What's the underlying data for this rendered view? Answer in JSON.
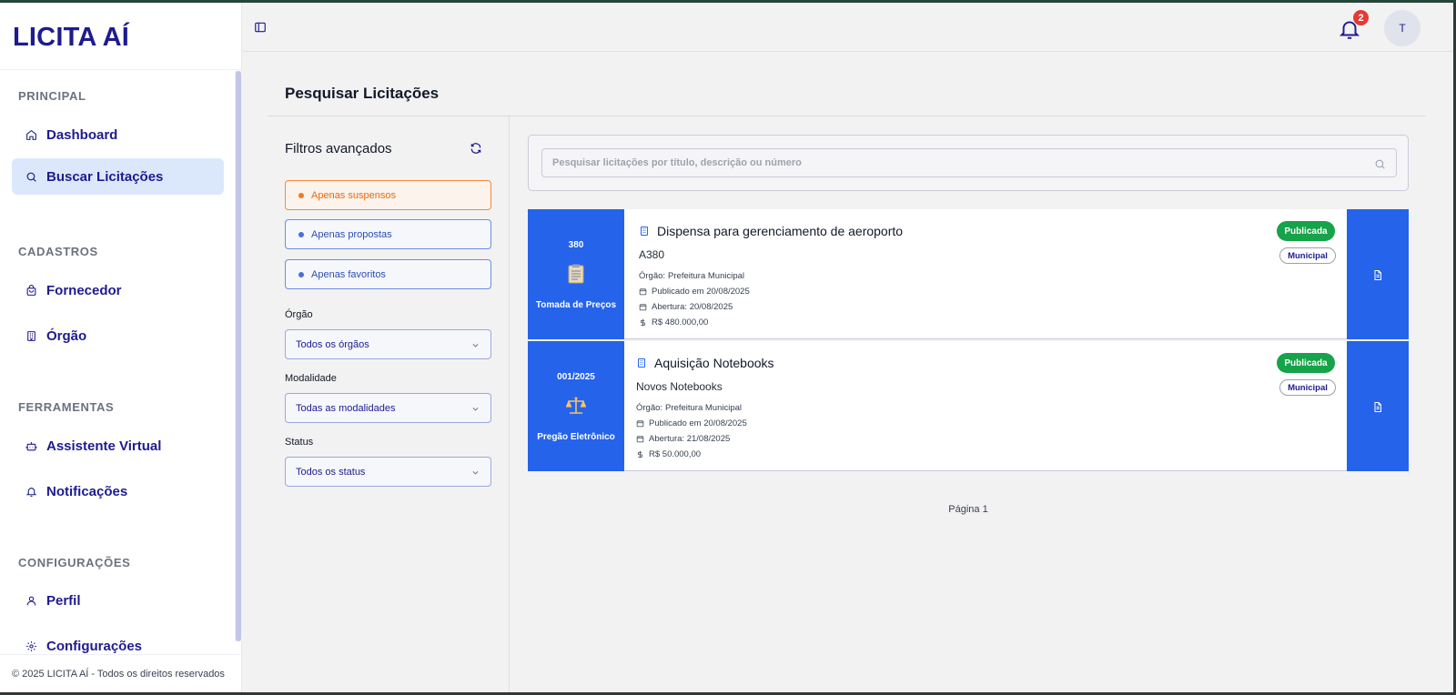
{
  "app": {
    "logo": "LICITA AÍ",
    "footer": "© 2025 LICITA AÍ - Todos os direitos reservados"
  },
  "colors": {
    "brand": "#1e1b8f",
    "accent": "#2563eb",
    "success": "#16a34a",
    "warning": "#f07a22",
    "danger": "#e53935"
  },
  "sidebar": {
    "sections": [
      {
        "label": "PRINCIPAL",
        "items": [
          {
            "label": "Dashboard",
            "icon": "home-icon"
          },
          {
            "label": "Buscar Licitações",
            "icon": "search-icon",
            "active": true
          }
        ]
      },
      {
        "label": "CADASTROS",
        "items": [
          {
            "label": "Fornecedor",
            "icon": "shopping-bag-icon"
          },
          {
            "label": "Órgão",
            "icon": "building-icon"
          }
        ]
      },
      {
        "label": "FERRAMENTAS",
        "items": [
          {
            "label": "Assistente Virtual",
            "icon": "bot-icon"
          },
          {
            "label": "Notificações",
            "icon": "bell-icon"
          }
        ]
      },
      {
        "label": "CONFIGURAÇÕES",
        "items": [
          {
            "label": "Perfil",
            "icon": "user-icon"
          },
          {
            "label": "Configurações",
            "icon": "gear-icon"
          }
        ]
      }
    ]
  },
  "header": {
    "notification_count": "2",
    "avatar_initial": "T"
  },
  "page": {
    "title": "Pesquisar Licitações"
  },
  "filters": {
    "title": "Filtros avançados",
    "toggles": [
      "Apenas suspensos",
      "Apenas propostas",
      "Apenas favoritos"
    ],
    "orgao": {
      "label": "Órgão",
      "value": "Todos os órgãos"
    },
    "modalidade": {
      "label": "Modalidade",
      "value": "Todas as modalidades"
    },
    "status": {
      "label": "Status",
      "value": "Todos os status"
    }
  },
  "search": {
    "placeholder": "Pesquisar licitações por título, descrição ou número"
  },
  "results": [
    {
      "number": "380",
      "modality": "Tomada de Preços",
      "modality_icon": "clipboard-icon",
      "title": "Dispensa para gerenciamento de aeroporto",
      "subtitle": "A380",
      "orgao_label": "Órgão:",
      "orgao": "Prefeitura Municipal",
      "published": "Publicado em 20/08/2025",
      "opening": "Abertura: 20/08/2025",
      "value": "R$ 480.000,00",
      "status": "Publicada",
      "sphere": "Municipal"
    },
    {
      "number": "001/2025",
      "modality": "Pregão Eletrônico",
      "modality_icon": "scales-icon",
      "title": "Aquisição Notebooks",
      "subtitle": "Novos Notebooks",
      "orgao_label": "Órgão:",
      "orgao": "Prefeitura Municipal",
      "published": "Publicado em 20/08/2025",
      "opening": "Abertura: 21/08/2025",
      "value": "R$ 50.000,00",
      "status": "Publicada",
      "sphere": "Municipal"
    }
  ],
  "pagination": {
    "label": "Página 1"
  }
}
